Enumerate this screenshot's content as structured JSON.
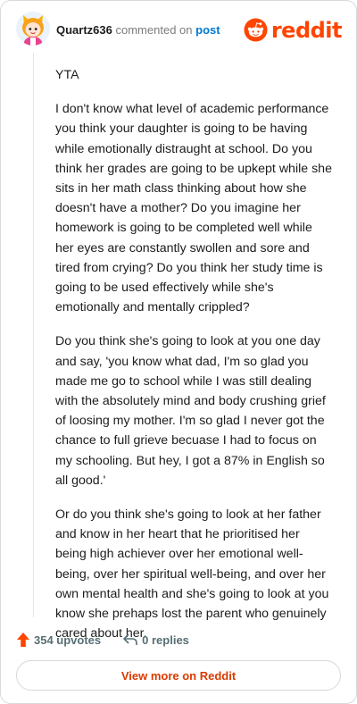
{
  "header": {
    "username": "Quartz636",
    "action_text": "commented on",
    "post_link": "post",
    "brand": "reddit"
  },
  "comment": {
    "paragraphs": [
      "YTA",
      "I don't know what level of academic performance you think your daughter is going to be having while emotionally distraught at school. Do you think her grades are going to be upkept while she sits in her math class thinking about how she doesn't have a mother? Do you imagine her homework is going to be completed well while her eyes are constantly swollen and sore and tired from crying? Do you think her study time is going to be used effectively while she's emotionally and mentally crippled?",
      "Do you think she's going to look at you one day and say, 'you know what dad, I'm so glad you made me go to school while I was still dealing with the absolutely mind and body crushing grief of loosing my mother. I'm so glad I never got the chance to full grieve becuase I had to focus on my schooling. But hey, I got a 87% in English so all good.'",
      "Or do you think she's going to look at her father and know in her heart that he prioritised her being high achiever over her emotional well-being, over her spiritual well-being, and over her own mental health and she's going to look at you know she prehaps lost the parent who genuinely cared about her."
    ]
  },
  "footer": {
    "upvotes": "354 upvotes",
    "replies": "0 replies",
    "view_more": "View more on Reddit"
  },
  "colors": {
    "brand": "#ff4500",
    "link": "#0079d3",
    "muted": "#576f76",
    "view_more_text": "#d93a00"
  }
}
